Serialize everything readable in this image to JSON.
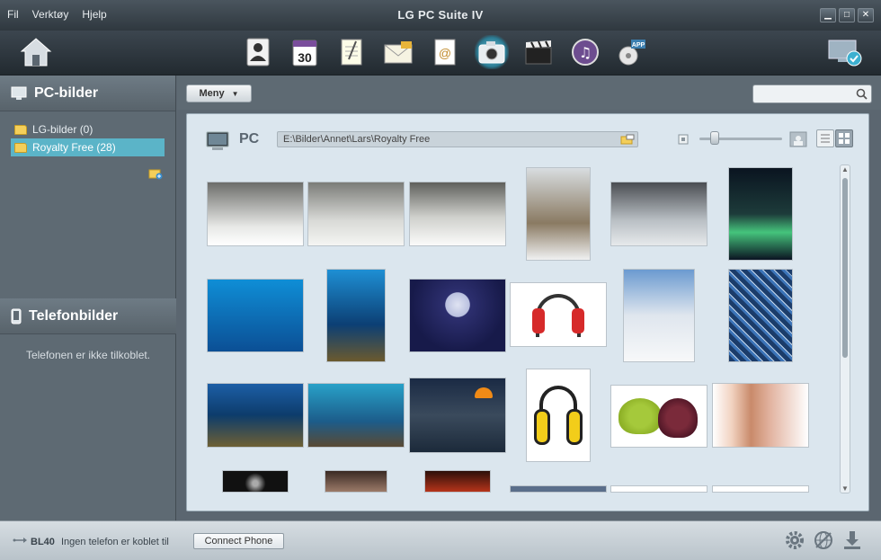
{
  "window": {
    "title": "LG PC Suite IV",
    "menu": [
      "Fil",
      "Verktøy",
      "Hjelp"
    ],
    "controls": [
      "minimize",
      "maximize",
      "close"
    ]
  },
  "toolbar": {
    "home_icon": "home-icon",
    "tools": [
      {
        "name": "contacts",
        "icon": "contacts-icon"
      },
      {
        "name": "calendar",
        "icon": "calendar-icon",
        "text": "30"
      },
      {
        "name": "memo",
        "icon": "memo-icon"
      },
      {
        "name": "messages",
        "icon": "envelope-icon"
      },
      {
        "name": "email",
        "icon": "email-icon"
      },
      {
        "name": "photos",
        "icon": "camera-icon",
        "active": true
      },
      {
        "name": "video",
        "icon": "clapper-icon"
      },
      {
        "name": "music",
        "icon": "music-icon"
      },
      {
        "name": "apps",
        "icon": "app-cd-icon",
        "text": "APP"
      }
    ],
    "monitor_icon": "monitor-sync-icon"
  },
  "sidebar": {
    "pc_title": "PC-bilder",
    "folders": [
      {
        "label": "LG-bilder (0)",
        "selected": false
      },
      {
        "label": "Royalty Free (28)",
        "selected": true
      }
    ],
    "phone_title": "Telefonbilder",
    "phone_message": "Telefonen er ikke tilkoblet."
  },
  "main": {
    "menu_label": "Meny",
    "search_placeholder": "",
    "location_label": "PC",
    "path": "E:\\Bilder\\Annet\\Lars\\Royalty Free",
    "zoom_level": 0.15,
    "view_mode": "grid"
  },
  "status": {
    "device": "BL40",
    "message": "Ingen telefon er koblet til",
    "connect_label": "Connect Phone"
  }
}
